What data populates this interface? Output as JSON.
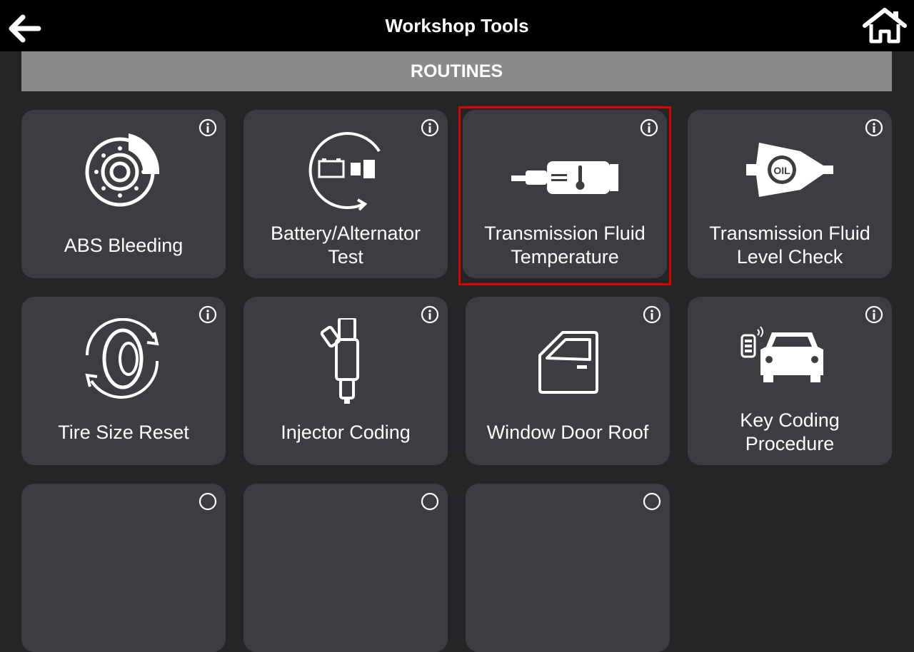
{
  "header": {
    "title": "Workshop Tools",
    "back_icon": "back-arrow-icon",
    "home_icon": "home-icon"
  },
  "section": {
    "title": "ROUTINES"
  },
  "tiles": [
    {
      "label": "ABS Bleeding",
      "icon": "brake-disc-icon",
      "info_icon": "info-icon"
    },
    {
      "label": "Battery/Alternator Test",
      "icon": "battery-alternator-icon",
      "info_icon": "info-icon"
    },
    {
      "label": "Transmission Fluid Temperature",
      "icon": "transmission-temperature-icon",
      "info_icon": "info-icon",
      "selected": true
    },
    {
      "label": "Transmission Fluid Level Check",
      "icon": "transmission-oil-icon",
      "info_icon": "info-icon"
    },
    {
      "label": "Tire Size Reset",
      "icon": "tire-rotation-icon",
      "info_icon": "info-icon"
    },
    {
      "label": "Injector Coding",
      "icon": "fuel-injector-icon",
      "info_icon": "info-icon"
    },
    {
      "label": "Window Door Roof",
      "icon": "car-door-icon",
      "info_icon": "info-icon"
    },
    {
      "label": "Key Coding Procedure",
      "icon": "car-key-fob-icon",
      "info_icon": "info-icon"
    }
  ],
  "colors": {
    "background": "#242527",
    "tile": "#3b3d40",
    "header": "#000000",
    "section": "#8a8a8a",
    "selection_border": "#e00000"
  }
}
